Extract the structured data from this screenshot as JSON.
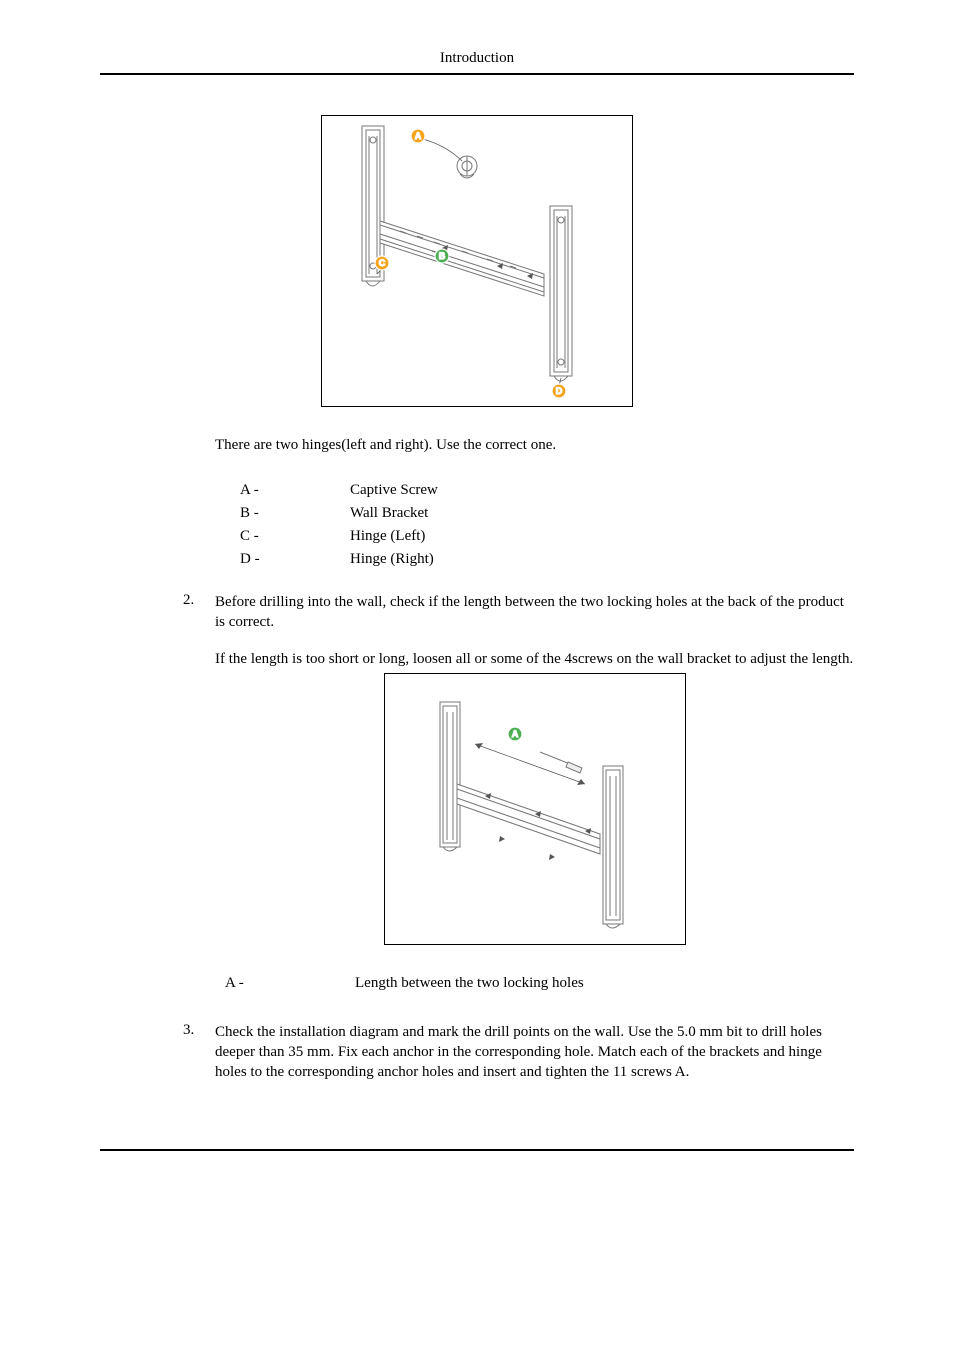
{
  "header": {
    "title": "Introduction"
  },
  "note_hinges": "There are two hinges(left and right). Use the correct one.",
  "legend1": {
    "A": {
      "key": "A -",
      "val": "Captive Screw"
    },
    "B": {
      "key": "B -",
      "val": "Wall Bracket"
    },
    "C": {
      "key": "C -",
      "val": "Hinge (Left)"
    },
    "D": {
      "key": "D -",
      "val": "Hinge (Right)"
    }
  },
  "step2": {
    "num": "2.",
    "p1": "Before drilling into the wall, check if the length between the two locking holes at the back of the product is correct.",
    "p2": "If the length is too short or long, loosen all or some of the 4screws on the wall bracket to adjust the length."
  },
  "legend2": {
    "A": {
      "key": "A -",
      "val": "Length between the two locking holes"
    }
  },
  "step3": {
    "num": "3.",
    "p1": "Check the installation diagram and mark the drill points on the wall. Use the 5.0 mm bit to drill holes deeper than 35 mm. Fix each anchor in the corresponding hole. Match each of the brackets and hinge holes to the corresponding anchor holes and insert and tighten the 11 screws A."
  },
  "labels": {
    "A": "A",
    "B": "B",
    "C": "C",
    "D": "D"
  },
  "colors": {
    "dot_abc": "#f5a31a",
    "dot_d": "#f5a31a"
  }
}
